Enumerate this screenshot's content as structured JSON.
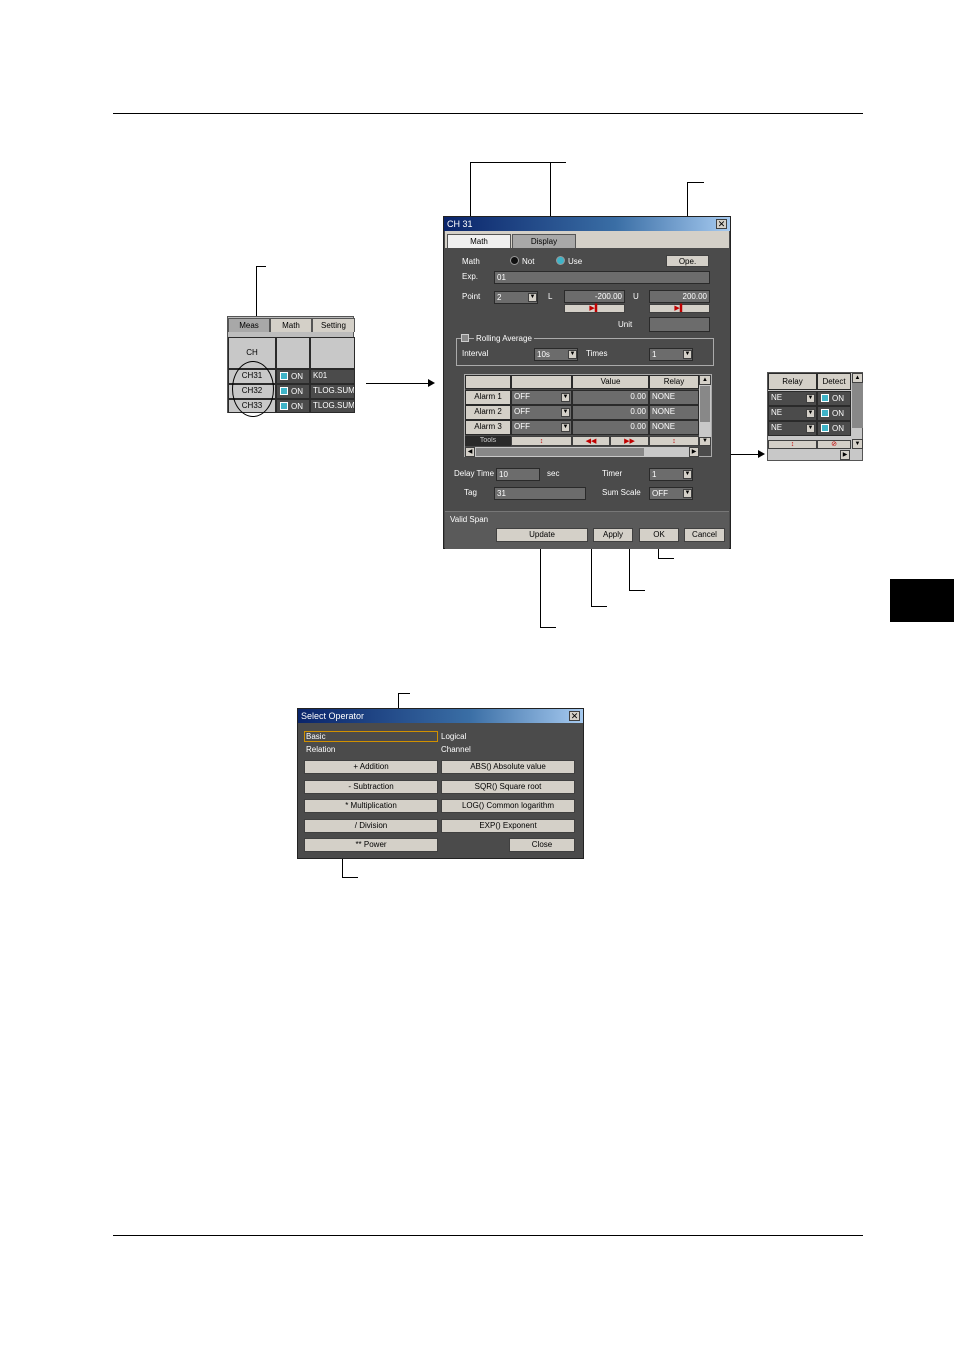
{
  "ch_dialog": {
    "title": "CH 31",
    "tabs": [
      "Math",
      "Display"
    ],
    "math_label": "Math",
    "radio_not": "Not",
    "radio_use": "Use",
    "ope_button": "Ope.",
    "exp_label": "Exp.",
    "exp_value": "01",
    "point_label": "Point",
    "point_value": "2",
    "l_label": "L",
    "l_value": "-200.00",
    "u_label": "U",
    "u_value": "200.00",
    "unit_label": "Unit",
    "rolling_label": "Rolling Average",
    "interval_label": "Interval",
    "interval_value": "10s",
    "times_label": "Times",
    "times_value": "1",
    "table_headers": [
      "",
      "",
      "Value",
      "Relay"
    ],
    "alarms": [
      {
        "name": "Alarm 1",
        "type": "OFF",
        "value": "0.00",
        "relay": "NONE"
      },
      {
        "name": "Alarm 2",
        "type": "OFF",
        "value": "0.00",
        "relay": "NONE"
      },
      {
        "name": "Alarm 3",
        "type": "OFF",
        "value": "0.00",
        "relay": "NONE"
      }
    ],
    "tools_label": "Tools",
    "delay_label": "Delay Time",
    "delay_value": "10",
    "delay_unit": "sec",
    "timer_label": "Timer",
    "timer_value": "1",
    "tag_label": "Tag",
    "tag_value": "31",
    "sum_scale_label": "Sum Scale",
    "sum_scale_value": "OFF",
    "valid_span_label": "Valid Span",
    "buttons": {
      "update": "Update",
      "apply": "Apply",
      "ok": "OK",
      "cancel": "Cancel"
    }
  },
  "left_panel": {
    "tabs": [
      "Meas",
      "Math",
      "Setting"
    ],
    "header": "CH",
    "rows": [
      {
        "ch": "CH31",
        "on": "ON",
        "expr": "K01"
      },
      {
        "ch": "CH32",
        "on": "ON",
        "expr": "TLOG.SUM"
      },
      {
        "ch": "CH33",
        "on": "ON",
        "expr": "TLOG.SUM"
      }
    ]
  },
  "right_panel": {
    "headers": [
      "Relay",
      "Detect"
    ],
    "rows": [
      {
        "relay": "NE",
        "on": "ON"
      },
      {
        "relay": "NE",
        "on": "ON"
      },
      {
        "relay": "NE",
        "on": "ON"
      }
    ]
  },
  "select_operator": {
    "title": "Select Operator",
    "categories": [
      "Basic",
      "Logical",
      "Relation",
      "Channel"
    ],
    "left_buttons": [
      "+ Addition",
      "- Subtraction",
      "* Multiplication",
      "/ Division",
      "** Power"
    ],
    "right_buttons": [
      "ABS() Absolute value",
      "SQR() Square root",
      "LOG() Common logarithm",
      "EXP() Exponent"
    ],
    "close_button": "Close"
  },
  "colors": {
    "dialog_bg": "#4b4b4b",
    "title_start": "#0a246a",
    "title_end": "#a6caf0",
    "button_face": "#d4d0c8",
    "accent_on": "#3fb4c8",
    "marker_red": "#c00000"
  }
}
